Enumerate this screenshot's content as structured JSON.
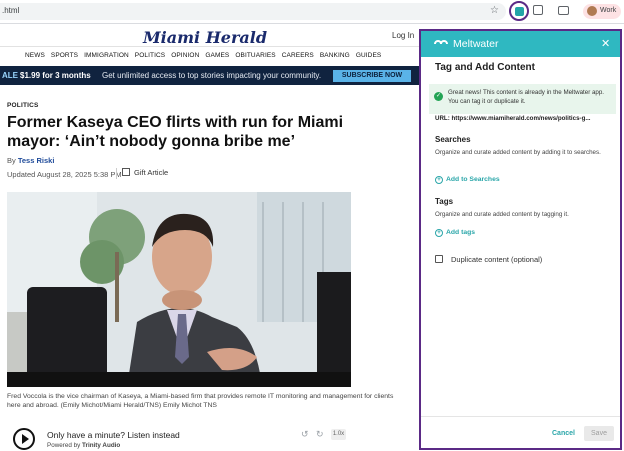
{
  "browser": {
    "url": ".html",
    "profile_label": "Work"
  },
  "site": {
    "logo": "Miami Herald",
    "login_label": "Log In",
    "nav_items": [
      "NEWS",
      "SPORTS",
      "IMMIGRATION",
      "POLITICS",
      "OPINION",
      "GAMES",
      "OBITUARIES",
      "CAREERS",
      "BANKING",
      "GUIDES"
    ]
  },
  "promo": {
    "tag": "ALE",
    "price": "$1.99 for 3 months",
    "message": "Get unlimited access to top stories impacting your community.",
    "subscribe_label": "SUBSCRIBE NOW"
  },
  "article": {
    "kicker": "POLITICS",
    "headline": "Former Kaseya CEO flirts with run for Miami mayor: ‘Ain’t nobody gonna bribe me’",
    "byline_prefix": "By",
    "author": "Tess Riski",
    "updated": "Updated August 28, 2025 5:38 PM",
    "gift_label": "Gift Article",
    "caption": "Fred Voccola is the vice chairman of Kaseya, a Miami-based firm that provides remote IT monitoring and management for clients here and abroad. (Emily Michot/Miami Herald/TNS) Emily Michot TNS"
  },
  "audio": {
    "prompt": "Only have a minute? Listen instead",
    "powered_prefix": "Powered by",
    "powered_brand": "Trinity Audio",
    "speed": "1.0x"
  },
  "panel": {
    "brand": "Meltwater",
    "title": "Tag and Add Content",
    "notice": "Great news! This content is already in the Meltwater app. You can tag it or duplicate it.",
    "url_label": "URL:",
    "url_value": "https://www.miamiherald.com/news/politics-g...",
    "searches_title": "Searches",
    "searches_desc": "Organize and curate added content by adding it to searches.",
    "add_searches_label": "Add to Searches",
    "tags_title": "Tags",
    "tags_desc": "Organize and curate added content by tagging it.",
    "add_tags_label": "Add tags",
    "duplicate_label": "Duplicate content (optional)",
    "cancel_label": "Cancel",
    "save_label": "Save",
    "accent_color": "#2fb8c1",
    "highlight_border_color": "#5b2a86"
  }
}
